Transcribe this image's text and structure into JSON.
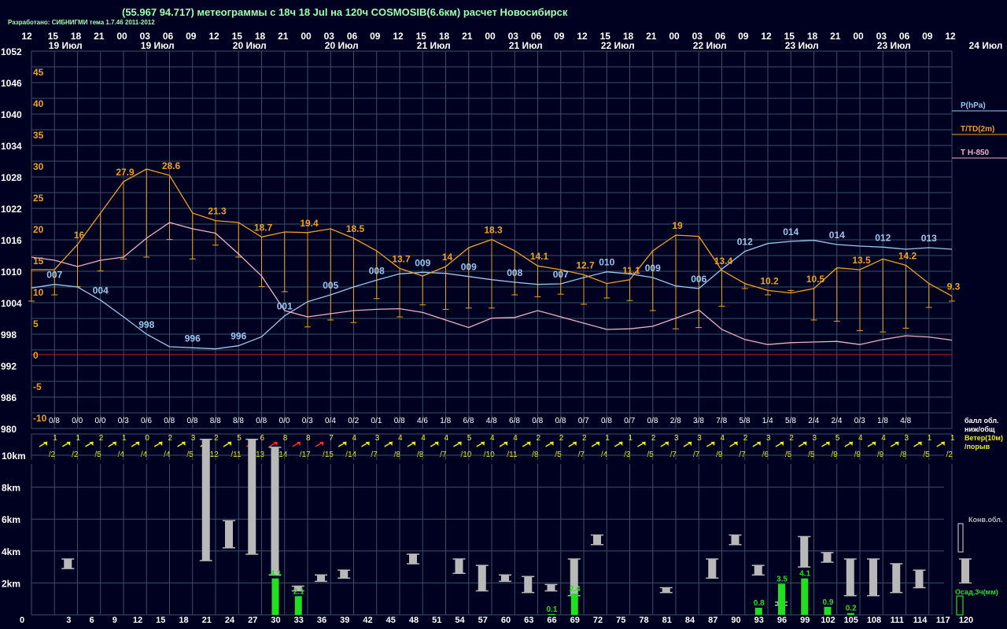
{
  "header": {
    "title": "(55.967 94.717) метеограммы с  18ч 18 Jul на 120ч COSMOSIB(6.6км) расчет Новосибирск",
    "credit": "Разработано: СИБНИГМИ тема 1.7.46 2011-2012"
  },
  "colors": {
    "background": "#000020",
    "grid": "#3a5064",
    "pressure": "#9ac8f0",
    "temperature": "#f0a020",
    "t850": "#f0b0c8",
    "wind": "#f0f000",
    "wind_strong": "#ff3020",
    "cloud": "#b8b8b8",
    "precip": "#20e020",
    "zero_line": "#c02020"
  },
  "chart_data": [
    {
      "type": "line",
      "name": "meteogram",
      "hour_ticks": [
        "12",
        "15",
        "18",
        "21",
        "00",
        "03",
        "06",
        "09",
        "12",
        "15",
        "18",
        "21",
        "00",
        "03",
        "06",
        "09",
        "12",
        "15",
        "18",
        "21",
        "00",
        "03",
        "06",
        "09",
        "12",
        "15",
        "18",
        "21",
        "00",
        "03",
        "06",
        "09",
        "12",
        "15",
        "18",
        "21",
        "00",
        "03",
        "06",
        "09",
        "12"
      ],
      "date_labels": [
        "19 Июл",
        "19 Июл",
        "20 Июл",
        "20 Июл",
        "21 Июл",
        "21 Июл",
        "22 Июл",
        "22 Июл",
        "23 Июл",
        "23 Июл"
      ],
      "date_label_end": "24 Июл",
      "pressure_ticks": [
        "1052",
        "1046",
        "1040",
        "1034",
        "1028",
        "1022",
        "1016",
        "1010",
        "1004",
        "998",
        "992",
        "986",
        "980"
      ],
      "temp_ticks": [
        "45",
        "40",
        "35",
        "30",
        "25",
        "20",
        "15",
        "10",
        "5",
        "0",
        "-5",
        "-10"
      ],
      "pressure_range": [
        980,
        1052
      ],
      "temp_range": [
        -10,
        47.5
      ],
      "legend": [
        "P(hPa)",
        "T/TD(2m)",
        "T H-850"
      ],
      "series": [
        {
          "name": "P(hPa)",
          "values": [
            1006.8,
            1007.5,
            1007,
            1004.5,
            1001.3,
            998,
            995.6,
            995.4,
            995.2,
            995.8,
            997.5,
            1001.5,
            1004.2,
            1005.5,
            1007,
            1008.3,
            1009.5,
            1009.8,
            1009.6,
            1009,
            1008.4,
            1007.9,
            1007.5,
            1007.6,
            1008.8,
            1009.9,
            1009.5,
            1008.8,
            1007.2,
            1006.7,
            1010.4,
            1013.8,
            1015.3,
            1015.7,
            1015.9,
            1015.1,
            1014.8,
            1014.6,
            1014.2,
            1014.5,
            1014.2
          ]
        },
        {
          "name": "T(2m)",
          "values": [
            13.5,
            13.5,
            17.5,
            22.5,
            27.5,
            29.5,
            28.5,
            22.5,
            21.3,
            21.0,
            18.7,
            19.5,
            19.4,
            20.0,
            18.5,
            16.5,
            13.7,
            12.5,
            14.0,
            17.0,
            18.3,
            16.5,
            14.1,
            13.5,
            12.7,
            11.3,
            11.9,
            16.5,
            19.0,
            18.8,
            13.4,
            11.3,
            10.2,
            9.8,
            10.5,
            13.8,
            13.5,
            15.2,
            14.2,
            11.3,
            9.3
          ]
        },
        {
          "name": "TD(2m)",
          "values": [
            8.5,
            9.5,
            10.8,
            13.3,
            15.2,
            15.5,
            18.3,
            15.2,
            17.4,
            15.5,
            10.8,
            10.0,
            4.4,
            5.5,
            5.1,
            8.9,
            6.0,
            7.9,
            7.2,
            7.4,
            7.4,
            9.5,
            9.2,
            9.6,
            8.0,
            9.0,
            8.6,
            7.0,
            4.1,
            4.3,
            7.7,
            10.5,
            9.5,
            10.2,
            5.5,
            5.3,
            3.8,
            3.6,
            4.2,
            7.5,
            8.5
          ]
        },
        {
          "name": "T H-850",
          "values": [
            15.5,
            15,
            14,
            15,
            15.5,
            18.5,
            21,
            20,
            19.3,
            16,
            12.5,
            7,
            6,
            6.5,
            7,
            7.2,
            7.3,
            6.7,
            5.5,
            4.3,
            5.8,
            5.9,
            7,
            6,
            5,
            4,
            4.1,
            4.5,
            5.8,
            7.1,
            4,
            2.4,
            1.6,
            1.9,
            2.0,
            2.1,
            1.6,
            2.4,
            3.0,
            2.8,
            2.3
          ]
        }
      ],
      "pressure_labels": [
        {
          "i": 1,
          "text": "007"
        },
        {
          "i": 3,
          "text": "004"
        },
        {
          "i": 5,
          "text": "998"
        },
        {
          "i": 7,
          "text": "996"
        },
        {
          "i": 9,
          "text": "996"
        },
        {
          "i": 11,
          "text": "001"
        },
        {
          "i": 13,
          "text": "005"
        },
        {
          "i": 15,
          "text": "008"
        },
        {
          "i": 17,
          "text": "009"
        },
        {
          "i": 19,
          "text": "009"
        },
        {
          "i": 21,
          "text": "008"
        },
        {
          "i": 23,
          "text": "007"
        },
        {
          "i": 25,
          "text": "010"
        },
        {
          "i": 27,
          "text": "009"
        },
        {
          "i": 29,
          "text": "006"
        },
        {
          "i": 31,
          "text": "012"
        },
        {
          "i": 33,
          "text": "014"
        },
        {
          "i": 35,
          "text": "014"
        },
        {
          "i": 37,
          "text": "012"
        },
        {
          "i": 39,
          "text": "013"
        }
      ],
      "temp_labels": [
        {
          "i": 2,
          "text": "16"
        },
        {
          "i": 4,
          "text": "27.9"
        },
        {
          "i": 6,
          "text": "28.6"
        },
        {
          "i": 8,
          "text": "21.3"
        },
        {
          "i": 10,
          "text": "18.7"
        },
        {
          "i": 12,
          "text": "19.4"
        },
        {
          "i": 14,
          "text": "18.5"
        },
        {
          "i": 16,
          "text": "13.7"
        },
        {
          "i": 18,
          "text": "14"
        },
        {
          "i": 20,
          "text": "18.3"
        },
        {
          "i": 22,
          "text": "14.1"
        },
        {
          "i": 24,
          "text": "12.7"
        },
        {
          "i": 26,
          "text": "11.1"
        },
        {
          "i": 28,
          "text": "19"
        },
        {
          "i": 30,
          "text": "13.4"
        },
        {
          "i": 32,
          "text": "10.2"
        },
        {
          "i": 34,
          "text": "10.5"
        },
        {
          "i": 36,
          "text": "13.5"
        },
        {
          "i": 38,
          "text": "14.2"
        },
        {
          "i": 40,
          "text": "9.3"
        }
      ]
    },
    {
      "type": "table",
      "name": "cloud-cover",
      "label": "балл обл. ниж/общ",
      "values": [
        "0/8",
        "0/0",
        "0/0",
        "0/3",
        "0/6",
        "0/8",
        "0/8",
        "8/8",
        "8/8",
        "0/8",
        "0/0",
        "0/3",
        "0/4",
        "0/2",
        "0/1",
        "0/8",
        "4/6",
        "1/8",
        "6/8",
        "4/8",
        "6/8",
        "0/8",
        "0/8",
        "0/7",
        "0/8",
        "0/7",
        "0/8",
        "2/8",
        "3/8",
        "7/8",
        "5/8",
        "1/4",
        "5/8",
        "2/4",
        "2/4",
        "0/3",
        "1/8",
        "4/8"
      ]
    },
    {
      "type": "table",
      "name": "wind",
      "label": "Ветер(10м) /порыв",
      "speed": [
        "1",
        "1",
        "2",
        "1",
        "0",
        "2",
        "3",
        "2",
        "5",
        "6",
        "8",
        "8",
        "7",
        "4",
        "3",
        "4",
        "4",
        "4",
        "5",
        "4",
        "4",
        "2",
        "2",
        "2",
        "1",
        "1",
        "2",
        "3",
        "3",
        "4",
        "2",
        "3",
        "2",
        "3",
        "5",
        "4",
        "4",
        "3",
        "1",
        "1"
      ],
      "gust": [
        "/2",
        "/2",
        "/5",
        "/4",
        "/4",
        "/4",
        "/5",
        "/12",
        "/11",
        "/13",
        "/14",
        "/17",
        "/15",
        "/14",
        "/7",
        "/8",
        "/8",
        "/7",
        "/10",
        "/10",
        "/11",
        "/8",
        "/5",
        "/7",
        "/4",
        "/3",
        "/5",
        "/7",
        "/7",
        "/9",
        "/7",
        "/6",
        "/5",
        "/5",
        "/9",
        "/9",
        "/9",
        "/8",
        "/5",
        "/2"
      ]
    },
    {
      "type": "bar",
      "name": "convective-clouds-precip",
      "x_ticks": [
        "0",
        "3",
        "6",
        "9",
        "12",
        "15",
        "18",
        "21",
        "24",
        "27",
        "30",
        "33",
        "36",
        "39",
        "42",
        "45",
        "48",
        "51",
        "54",
        "57",
        "60",
        "63",
        "66",
        "69",
        "72",
        "75",
        "78",
        "81",
        "84",
        "87",
        "90",
        "93",
        "96",
        "99",
        "102",
        "105",
        "108",
        "111",
        "114",
        "117",
        "120"
      ],
      "y_ticks": [
        "10km",
        "8km",
        "6km",
        "4km",
        "2km"
      ],
      "legend": [
        "Конв.обл.",
        "Осад,3ч(мм)"
      ],
      "cloud_layers_km": [
        [
          1,
          2.9,
          3.5
        ],
        [
          7,
          3.4,
          11
        ],
        [
          8,
          4.2,
          5.9
        ],
        [
          9,
          3.8,
          11
        ],
        [
          10,
          2.5,
          10.5
        ],
        [
          11,
          1.5,
          1.8
        ],
        [
          12,
          2.1,
          2.5
        ],
        [
          13,
          2.3,
          2.8
        ],
        [
          16,
          3.2,
          3.8
        ],
        [
          18,
          2.6,
          3.5
        ],
        [
          19,
          1.5,
          3.1
        ],
        [
          20,
          2.1,
          2.5
        ],
        [
          21,
          1.4,
          2.4
        ],
        [
          22,
          1.5,
          1.9
        ],
        [
          23,
          1.2,
          3.5
        ],
        [
          24,
          4.4,
          5
        ],
        [
          27,
          1.4,
          1.7
        ],
        [
          29,
          2.3,
          3.5
        ],
        [
          30,
          4.4,
          5
        ],
        [
          31,
          2.5,
          3.1
        ],
        [
          32,
          0.6,
          0.8
        ],
        [
          33,
          3,
          4.9
        ],
        [
          34,
          3.3,
          3.9
        ],
        [
          35,
          1.2,
          3.5
        ],
        [
          36,
          1.2,
          3.5
        ],
        [
          37,
          1.4,
          3.2
        ],
        [
          38,
          1.7,
          2.8
        ],
        [
          40,
          2,
          3.5
        ]
      ],
      "precip": [
        {
          "i": 10,
          "text": "4.1",
          "value": 4.1
        },
        {
          "i": 11,
          "text": "2.1",
          "value": 2.1
        },
        {
          "i": 22,
          "text": "0.1",
          "value": 0.1
        },
        {
          "i": 23,
          "text": "2.4",
          "value": 2.4
        },
        {
          "i": 31,
          "text": "0.8",
          "value": 0.8
        },
        {
          "i": 32,
          "text": "3.5",
          "value": 3.5
        },
        {
          "i": 33,
          "text": "4.1",
          "value": 4.1
        },
        {
          "i": 34,
          "text": "0.9",
          "value": 0.9
        },
        {
          "i": 35,
          "text": "0.2",
          "value": 0.2
        }
      ]
    }
  ]
}
